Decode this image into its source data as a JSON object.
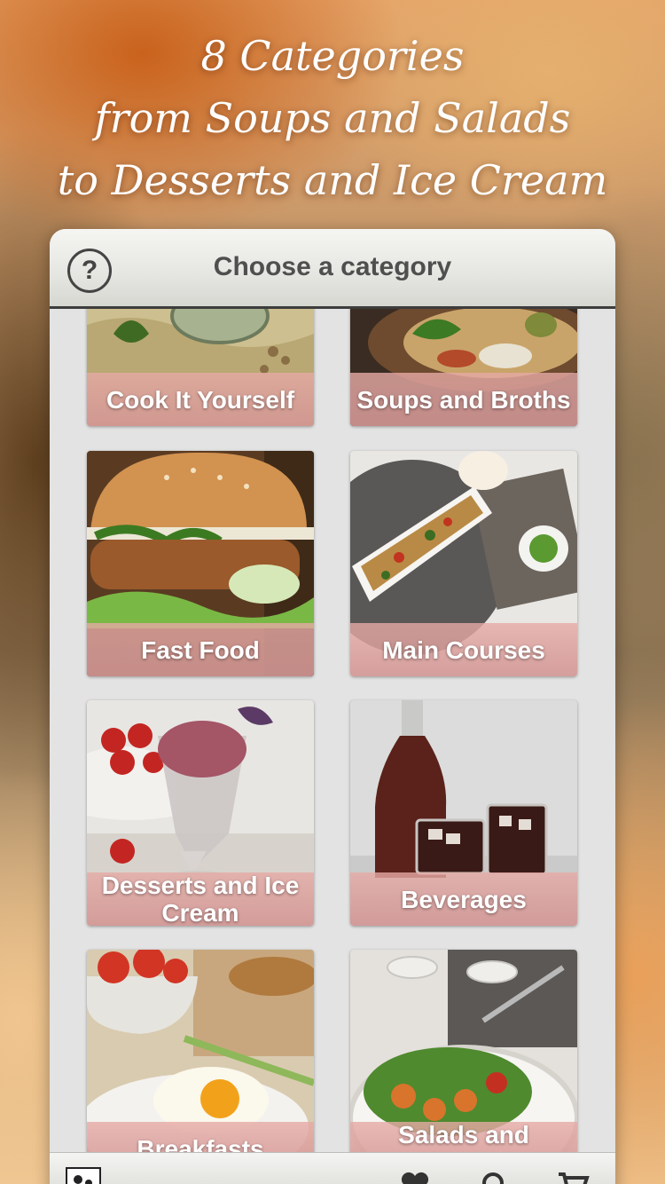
{
  "headline": {
    "line1": "8 Categories",
    "line2": "from Soups and Salads",
    "line3": "to Desserts and Ice Cream"
  },
  "header": {
    "help_label": "?",
    "title": "Choose a category"
  },
  "categories": [
    {
      "label": "Cook It Yourself"
    },
    {
      "label": "Soups and Broths"
    },
    {
      "label": "Fast Food"
    },
    {
      "label": "Main Courses"
    },
    {
      "label": "Desserts and Ice Cream"
    },
    {
      "label": "Beverages"
    },
    {
      "label": "Breakfasts"
    },
    {
      "label": "Salads and Starters"
    }
  ],
  "tab_bar": {
    "icons": [
      "app-logo-icon",
      "heart-icon",
      "search-icon",
      "cart-icon"
    ]
  },
  "colors": {
    "label_bar": "#d8a3a0",
    "header_border": "#3d3d3d",
    "panel_bg": "#e3e3e3"
  }
}
